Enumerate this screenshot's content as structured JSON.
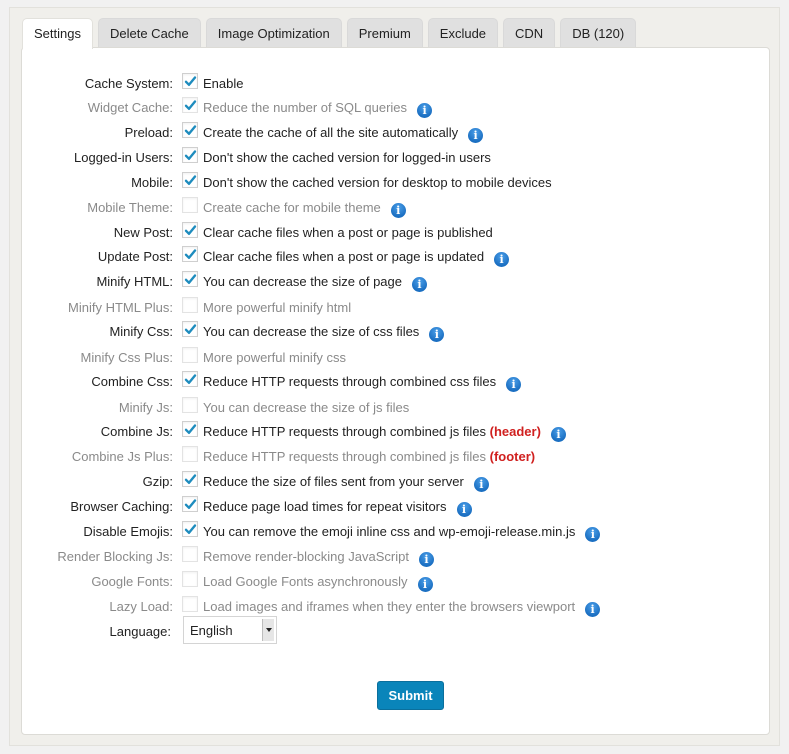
{
  "tabs": [
    {
      "label": "Settings",
      "active": true
    },
    {
      "label": "Delete Cache",
      "active": false
    },
    {
      "label": "Image Optimization",
      "active": false
    },
    {
      "label": "Premium",
      "active": false
    },
    {
      "label": "Exclude",
      "active": false
    },
    {
      "label": "CDN",
      "active": false
    },
    {
      "label": "DB (120)",
      "active": false
    }
  ],
  "settings": [
    {
      "label": "Cache System:",
      "desc": "Enable",
      "checked": true,
      "disabled": false,
      "info": false
    },
    {
      "label": "Widget Cache:",
      "desc": "Reduce the number of SQL queries",
      "checked": true,
      "disabled": true,
      "info": true
    },
    {
      "label": "Preload:",
      "desc": "Create the cache of all the site automatically",
      "checked": true,
      "disabled": false,
      "info": true
    },
    {
      "label": "Logged-in Users:",
      "desc": "Don't show the cached version for logged-in users",
      "checked": true,
      "disabled": false,
      "info": false
    },
    {
      "label": "Mobile:",
      "desc": "Don't show the cached version for desktop to mobile devices",
      "checked": true,
      "disabled": false,
      "info": false
    },
    {
      "label": "Mobile Theme:",
      "desc": "Create cache for mobile theme",
      "checked": false,
      "disabled": true,
      "info": true
    },
    {
      "label": "New Post:",
      "desc": "Clear cache files when a post or page is published",
      "checked": true,
      "disabled": false,
      "info": false
    },
    {
      "label": "Update Post:",
      "desc": "Clear cache files when a post or page is updated",
      "checked": true,
      "disabled": false,
      "info": true
    },
    {
      "label": "Minify HTML:",
      "desc": "You can decrease the size of page",
      "checked": true,
      "disabled": false,
      "info": true
    },
    {
      "label": "Minify HTML Plus:",
      "desc": "More powerful minify html",
      "checked": false,
      "disabled": true,
      "info": false
    },
    {
      "label": "Minify Css:",
      "desc": "You can decrease the size of css files",
      "checked": true,
      "disabled": false,
      "info": true
    },
    {
      "label": "Minify Css Plus:",
      "desc": "More powerful minify css",
      "checked": false,
      "disabled": true,
      "info": false
    },
    {
      "label": "Combine Css:",
      "desc": "Reduce HTTP requests through combined css files",
      "checked": true,
      "disabled": false,
      "info": true
    },
    {
      "label": "Minify Js:",
      "desc": "You can decrease the size of js files",
      "checked": false,
      "disabled": true,
      "info": false
    },
    {
      "label": "Combine Js:",
      "desc": "Reduce HTTP requests through combined js files",
      "suffix": "(header)",
      "checked": true,
      "disabled": false,
      "info": true
    },
    {
      "label": "Combine Js Plus:",
      "desc": "Reduce HTTP requests through combined js files",
      "suffix": "(footer)",
      "checked": false,
      "disabled": true,
      "info": false
    },
    {
      "label": "Gzip:",
      "desc": "Reduce the size of files sent from your server",
      "checked": true,
      "disabled": false,
      "info": true
    },
    {
      "label": "Browser Caching:",
      "desc": "Reduce page load times for repeat visitors",
      "checked": true,
      "disabled": false,
      "info": true
    },
    {
      "label": "Disable Emojis:",
      "desc": "You can remove the emoji inline css and wp-emoji-release.min.js",
      "checked": true,
      "disabled": false,
      "info": true
    },
    {
      "label": "Render Blocking Js:",
      "desc": "Remove render-blocking JavaScript",
      "checked": false,
      "disabled": true,
      "info": true
    },
    {
      "label": "Google Fonts:",
      "desc": "Load Google Fonts asynchronously",
      "checked": false,
      "disabled": true,
      "info": true
    },
    {
      "label": "Lazy Load:",
      "desc": "Load images and iframes when they enter the browsers viewport",
      "checked": false,
      "disabled": true,
      "info": true
    }
  ],
  "language": {
    "label": "Language:",
    "selected": "English"
  },
  "submit_label": "Submit",
  "icons": {
    "info": "info-icon",
    "check": "checkmark-icon",
    "dropdown": "chevron-down-icon"
  },
  "colors": {
    "accent": "#0a85ba",
    "check": "#1e8cbe",
    "info": "#1e77cc",
    "highlight_red": "#d0201f"
  }
}
